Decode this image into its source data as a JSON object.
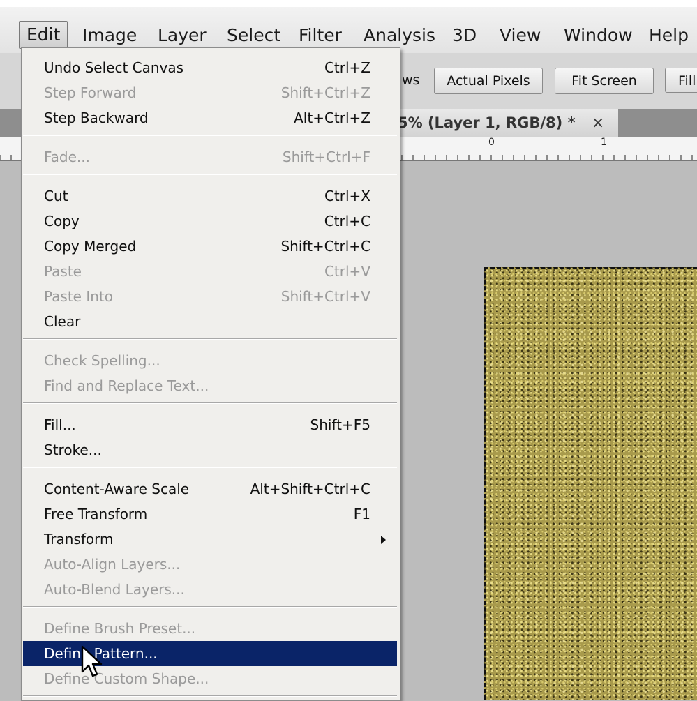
{
  "menubar": {
    "items": [
      "Edit",
      "Image",
      "Layer",
      "Select",
      "Filter",
      "Analysis",
      "3D",
      "View",
      "Window",
      "Help"
    ]
  },
  "optionsbar": {
    "partial_label": "ws",
    "buttons": [
      "Actual Pixels",
      "Fit Screen",
      "Fill"
    ]
  },
  "document_tab": {
    "title": "5% (Layer 1, RGB/8) *",
    "close": "×"
  },
  "ruler": {
    "ticks": [
      "0",
      "1"
    ]
  },
  "edit_menu": {
    "items": [
      {
        "label": "Undo Select Canvas",
        "shortcut": "Ctrl+Z",
        "enabled": true
      },
      {
        "label": "Step Forward",
        "shortcut": "Shift+Ctrl+Z",
        "enabled": false
      },
      {
        "label": "Step Backward",
        "shortcut": "Alt+Ctrl+Z",
        "enabled": true
      },
      {
        "label": "Fade...",
        "shortcut": "Shift+Ctrl+F",
        "enabled": false
      },
      {
        "label": "Cut",
        "shortcut": "Ctrl+X",
        "enabled": true
      },
      {
        "label": "Copy",
        "shortcut": "Ctrl+C",
        "enabled": true
      },
      {
        "label": "Copy Merged",
        "shortcut": "Shift+Ctrl+C",
        "enabled": true
      },
      {
        "label": "Paste",
        "shortcut": "Ctrl+V",
        "enabled": false
      },
      {
        "label": "Paste Into",
        "shortcut": "Shift+Ctrl+V",
        "enabled": false
      },
      {
        "label": "Clear",
        "shortcut": "",
        "enabled": true
      },
      {
        "label": "Check Spelling...",
        "shortcut": "",
        "enabled": false
      },
      {
        "label": "Find and Replace Text...",
        "shortcut": "",
        "enabled": false
      },
      {
        "label": "Fill...",
        "shortcut": "Shift+F5",
        "enabled": true
      },
      {
        "label": "Stroke...",
        "shortcut": "",
        "enabled": true
      },
      {
        "label": "Content-Aware Scale",
        "shortcut": "Alt+Shift+Ctrl+C",
        "enabled": true
      },
      {
        "label": "Free Transform",
        "shortcut": "F1",
        "enabled": true
      },
      {
        "label": "Transform",
        "shortcut": "",
        "enabled": true,
        "submenu": true
      },
      {
        "label": "Auto-Align Layers...",
        "shortcut": "",
        "enabled": false
      },
      {
        "label": "Auto-Blend Layers...",
        "shortcut": "",
        "enabled": false
      },
      {
        "label": "Define Brush Preset...",
        "shortcut": "",
        "enabled": false
      },
      {
        "label": "Define Pattern...",
        "shortcut": "",
        "enabled": true,
        "highlighted": true
      },
      {
        "label": "Define Custom Shape...",
        "shortcut": "",
        "enabled": false
      }
    ]
  },
  "colors": {
    "highlight": "#0a2468",
    "disabled_text": "#9a9a9a"
  },
  "icons": {
    "cursor": "mouse-pointer-icon",
    "submenu": "chevron-right-icon"
  }
}
